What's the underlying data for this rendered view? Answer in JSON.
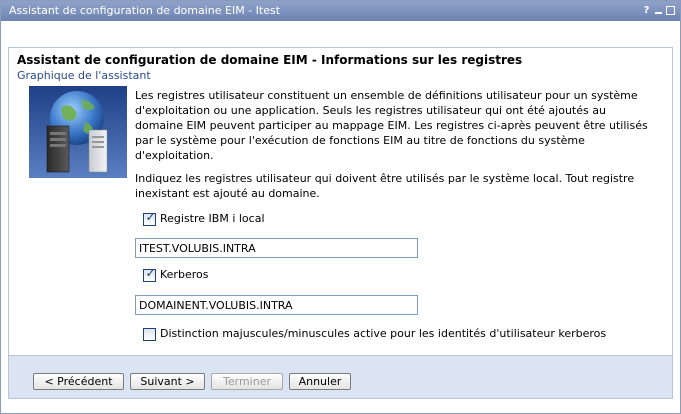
{
  "window": {
    "title": "Assistant de configuration de domaine EIM - Itest",
    "help_glyph": "?"
  },
  "page": {
    "title": "Assistant de configuration de domaine EIM - Informations sur les registres",
    "graphic_link": "Graphique de l'assistant",
    "description_1": "Les registres utilisateur constituent un ensemble de définitions utilisateur pour un système d'exploitation ou une application. Seuls les registres utilisateur qui ont été ajoutés au domaine EIM peuvent participer au mappage EIM. Les registres ci-après peuvent être utilisés par le système pour l'exécution de fonctions EIM au titre de fonctions du système d'exploitation.",
    "description_2": "Indiquez les registres utilisateur qui doivent être utilisés par le système local. Tout registre inexistant est ajouté au domaine."
  },
  "registries": {
    "local": {
      "label": "Registre IBM i local",
      "checked": true,
      "value": "ITEST.VOLUBIS.INTRA"
    },
    "kerberos": {
      "label": "Kerberos",
      "checked": true,
      "value": "DOMAINENT.VOLUBIS.INTRA"
    },
    "case_sensitive": {
      "label": "Distinction majuscules/minuscules active pour les identités d'utilisateur kerberos",
      "checked": false
    }
  },
  "buttons": {
    "previous": "< Précédent",
    "next": "Suivant >",
    "finish": "Terminer",
    "cancel": "Annuler"
  },
  "icons": {
    "illustration": "server-globe-illustration",
    "help": "help-icon",
    "minimize": "minimize-icon",
    "close": "close-icon",
    "checkbox_tick": "check-icon"
  },
  "colors": {
    "titlebar": "#7a8fbd",
    "button_bar": "#dbe4f3",
    "link": "#2a4a8a"
  }
}
